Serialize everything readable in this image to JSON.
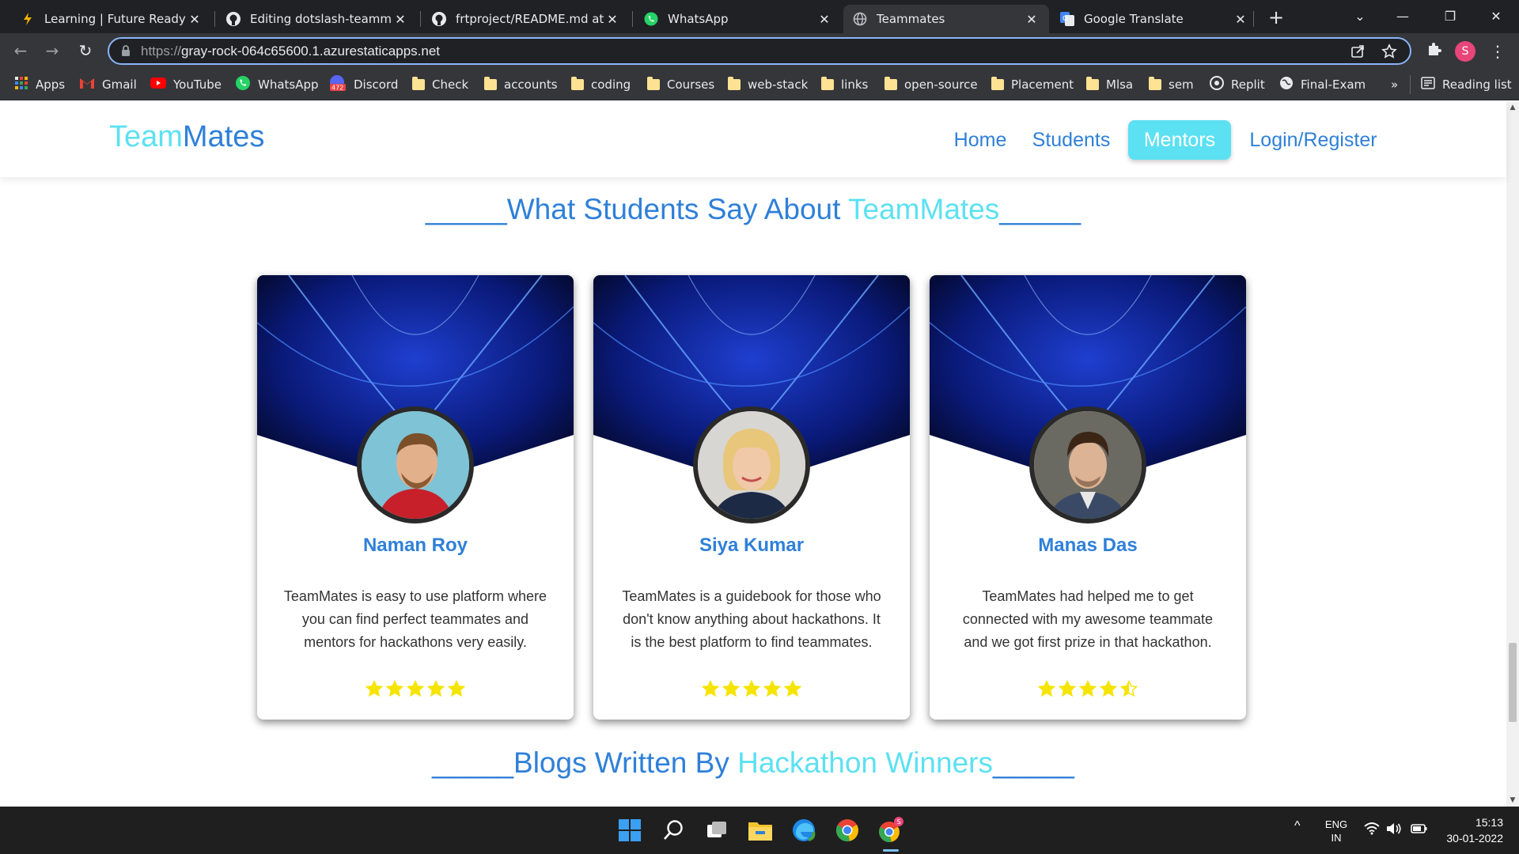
{
  "browser": {
    "tabs": [
      {
        "title": "Learning | Future Ready Tal",
        "icon": "future-ready-icon",
        "close": "✕"
      },
      {
        "title": "Editing dotslash-teammates",
        "icon": "github-icon",
        "close": "✕"
      },
      {
        "title": "frtproject/README.md at m",
        "icon": "github-icon",
        "close": "✕"
      },
      {
        "title": "WhatsApp",
        "icon": "whatsapp-icon",
        "close": "✕"
      },
      {
        "title": "Teammates",
        "icon": "globe-icon",
        "close": "✕",
        "active": true
      },
      {
        "title": "Google Translate",
        "icon": "google-translate-icon",
        "close": "✕"
      }
    ],
    "new_tab": "+",
    "window_controls": {
      "tab_search": "⌄",
      "minimize": "—",
      "restore": "❐",
      "close": "✕"
    },
    "toolbar": {
      "back": "←",
      "forward": "→",
      "reload": "↻",
      "url_scheme": "https://",
      "url_host": "gray-rock-064c65600.1.azurestaticapps.net",
      "profile_initial": "S",
      "menu": "⋮"
    },
    "bookmarks": [
      {
        "label": "Apps",
        "icon": "apps-grid-icon"
      },
      {
        "label": "Gmail",
        "icon": "gmail-icon"
      },
      {
        "label": "YouTube",
        "icon": "youtube-icon"
      },
      {
        "label": "WhatsApp",
        "icon": "whatsapp-icon"
      },
      {
        "label": "Discord",
        "icon": "discord-icon",
        "badge": "472"
      },
      {
        "label": "Check",
        "icon": "folder-icon"
      },
      {
        "label": "accounts",
        "icon": "folder-icon"
      },
      {
        "label": "coding",
        "icon": "folder-icon"
      },
      {
        "label": "Courses",
        "icon": "folder-icon"
      },
      {
        "label": "web-stack",
        "icon": "folder-icon"
      },
      {
        "label": "links",
        "icon": "folder-icon"
      },
      {
        "label": "open-source",
        "icon": "folder-icon"
      },
      {
        "label": "Placement",
        "icon": "folder-icon"
      },
      {
        "label": "Mlsa",
        "icon": "folder-icon"
      },
      {
        "label": "sem",
        "icon": "folder-icon"
      },
      {
        "label": "Replit",
        "icon": "replit-icon"
      },
      {
        "label": "Final-Exam",
        "icon": "globe-icon"
      }
    ],
    "bookmarks_overflow": "»",
    "reading_list": "Reading list"
  },
  "site": {
    "logo_part1": "Team",
    "logo_part2": "Mates",
    "nav": [
      {
        "label": "Home"
      },
      {
        "label": "Students"
      },
      {
        "label": "Mentors",
        "active": true
      },
      {
        "label": "Login/Register"
      }
    ],
    "testimonials_title": {
      "prefix": "_____What Students Say About ",
      "accent": "TeamMates",
      "suffix": "_____"
    },
    "testimonials": [
      {
        "name": "Naman Roy",
        "text": "TeamMates is easy to use platform where you can find perfect teammates and mentors for hackathons very easily.",
        "rating": 5
      },
      {
        "name": "Siya Kumar",
        "text": "TeamMates is a guidebook for those who don't know anything about hackathons. It is the best platform to find teammates.",
        "rating": 5
      },
      {
        "name": "Manas Das",
        "text": "TeamMates had helped me to get connected with my awesome teammate and we got first prize in that hackathon.",
        "rating": 4.5
      }
    ],
    "blogs_title": {
      "prefix": "_____Blogs Written By ",
      "accent": "Hackathon Winners",
      "suffix": "_____"
    }
  },
  "taskbar": {
    "icons": [
      "windows-start-icon",
      "search-icon",
      "task-view-icon",
      "file-explorer-icon",
      "edge-icon",
      "chrome-icon",
      "chrome-profile-icon"
    ],
    "language_line1": "ENG",
    "language_line2": "IN",
    "time": "15:13",
    "date": "30-01-2022",
    "tray_chevron": "^"
  },
  "colors": {
    "accent_cyan": "#5ce1f2",
    "brand_blue": "#2f80d8",
    "star_yellow": "#f5e400"
  }
}
